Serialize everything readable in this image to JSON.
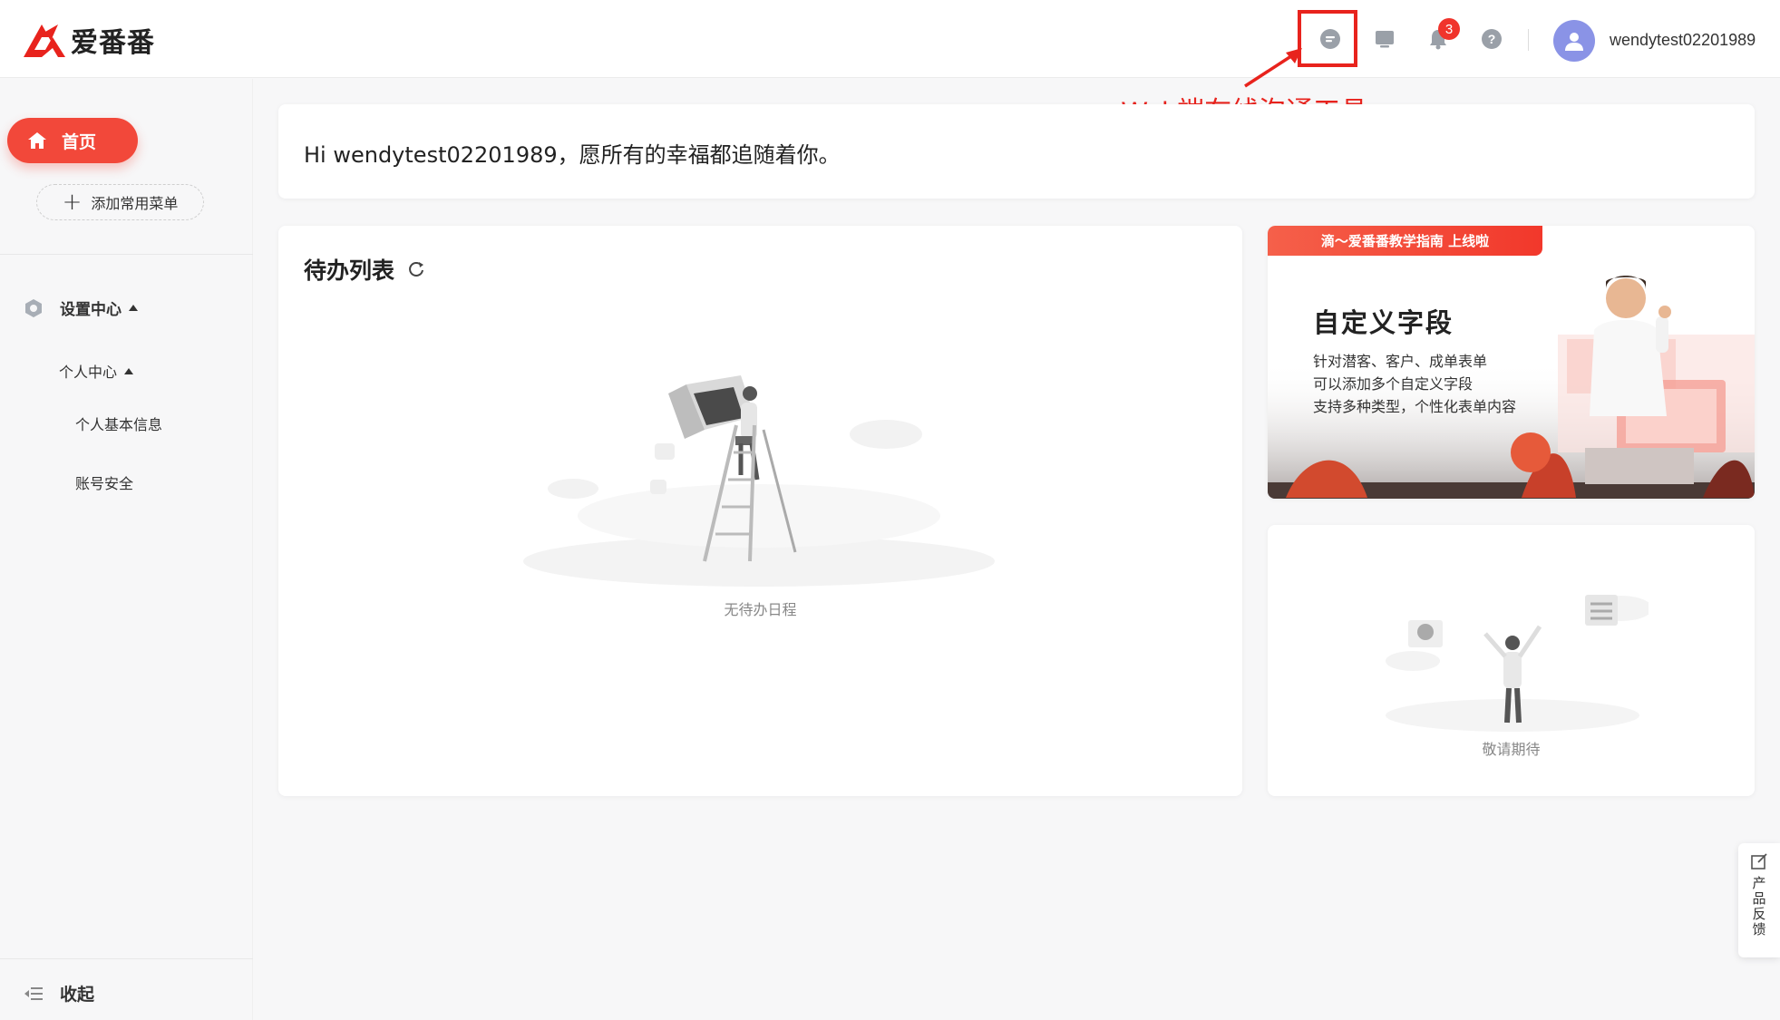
{
  "header": {
    "logo_text": "爱番番",
    "notification_count": "3",
    "username": "wendytest02201989",
    "icons": [
      "chat-icon",
      "monitor-icon",
      "bell-icon",
      "help-icon",
      "user-avatar-icon"
    ]
  },
  "annotation": {
    "text": "Web端在线沟通工具",
    "color": "#e8231d"
  },
  "sidebar": {
    "home_label": "首页",
    "add_menu_label": "添加常用菜单",
    "settings_label": "设置中心",
    "personal_center_label": "个人中心",
    "basic_info_label": "个人基本信息",
    "account_security_label": "账号安全",
    "collapse_label": "收起"
  },
  "main": {
    "greeting": "Hi wendytest02201989，愿所有的幸福都追随着你。",
    "todo": {
      "title": "待办列表",
      "empty_text": "无待办日程"
    },
    "banner": {
      "tag": "滴～爱番番教学指南 上线啦",
      "title": "自定义字段",
      "lines": [
        "针对潜客、客户、成单表单",
        "可以添加多个自定义字段",
        "支持多种类型，个性化表单内容"
      ]
    },
    "coming_soon": {
      "text": "敬请期待"
    }
  },
  "feedback": {
    "label": "产品反馈"
  },
  "colors": {
    "brand_red": "#f2483a",
    "badge_red": "#f0342c",
    "avatar_purple": "#8a93e6"
  }
}
